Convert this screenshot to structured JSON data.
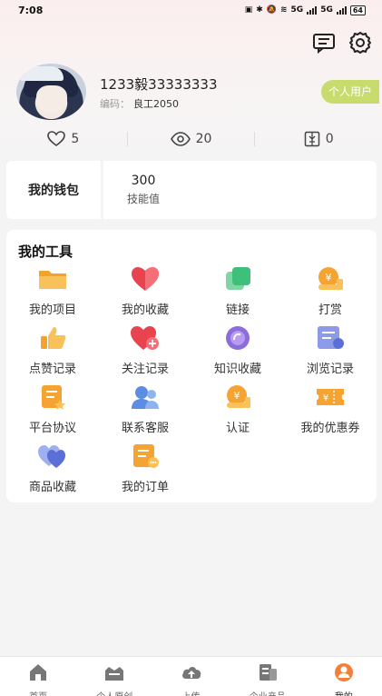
{
  "status_bar": {
    "time": "7:08",
    "net_a": "5G",
    "net_b": "5G",
    "battery": "64"
  },
  "profile": {
    "username": "1233毅33333333",
    "code_label": "编码：",
    "code_value": "良工2050",
    "badge": "个人用户"
  },
  "stats": {
    "likes": "5",
    "views": "20",
    "docs": "0"
  },
  "wallet": {
    "title": "我的钱包",
    "skill_value": "300",
    "skill_label": "技能值"
  },
  "tools": {
    "title": "我的工具",
    "items": [
      {
        "label": "我的项目",
        "icon": "folder-icon"
      },
      {
        "label": "我的收藏",
        "icon": "heart-icon"
      },
      {
        "label": "链接",
        "icon": "link-icon"
      },
      {
        "label": "打赏",
        "icon": "reward-icon"
      },
      {
        "label": "点赞记录",
        "icon": "thumbs-up-icon"
      },
      {
        "label": "关注记录",
        "icon": "follow-heart-icon"
      },
      {
        "label": "知识收藏",
        "icon": "knowledge-icon"
      },
      {
        "label": "浏览记录",
        "icon": "browse-history-icon"
      },
      {
        "label": "平台协议",
        "icon": "agreement-icon"
      },
      {
        "label": "联系客服",
        "icon": "customer-service-icon"
      },
      {
        "label": "认证",
        "icon": "certification-icon"
      },
      {
        "label": "我的优惠券",
        "icon": "coupon-icon"
      },
      {
        "label": "商品收藏",
        "icon": "product-favorite-icon"
      },
      {
        "label": "我的订单",
        "icon": "order-icon"
      }
    ]
  },
  "tabbar": {
    "items": [
      {
        "label": "首页",
        "icon": "home-icon"
      },
      {
        "label": "个人原创",
        "icon": "original-icon"
      },
      {
        "label": "上传",
        "icon": "upload-icon"
      },
      {
        "label": "企业产品",
        "icon": "enterprise-icon"
      },
      {
        "label": "我的",
        "icon": "profile-icon"
      }
    ],
    "active": "我的"
  },
  "colors": {
    "accent_orange": "#f5a431",
    "badge_green": "#c8dc6e",
    "heart_red": "#e8434f",
    "link_green": "#3ec07a",
    "purple": "#8c6ddc",
    "blue": "#5b8de4"
  }
}
